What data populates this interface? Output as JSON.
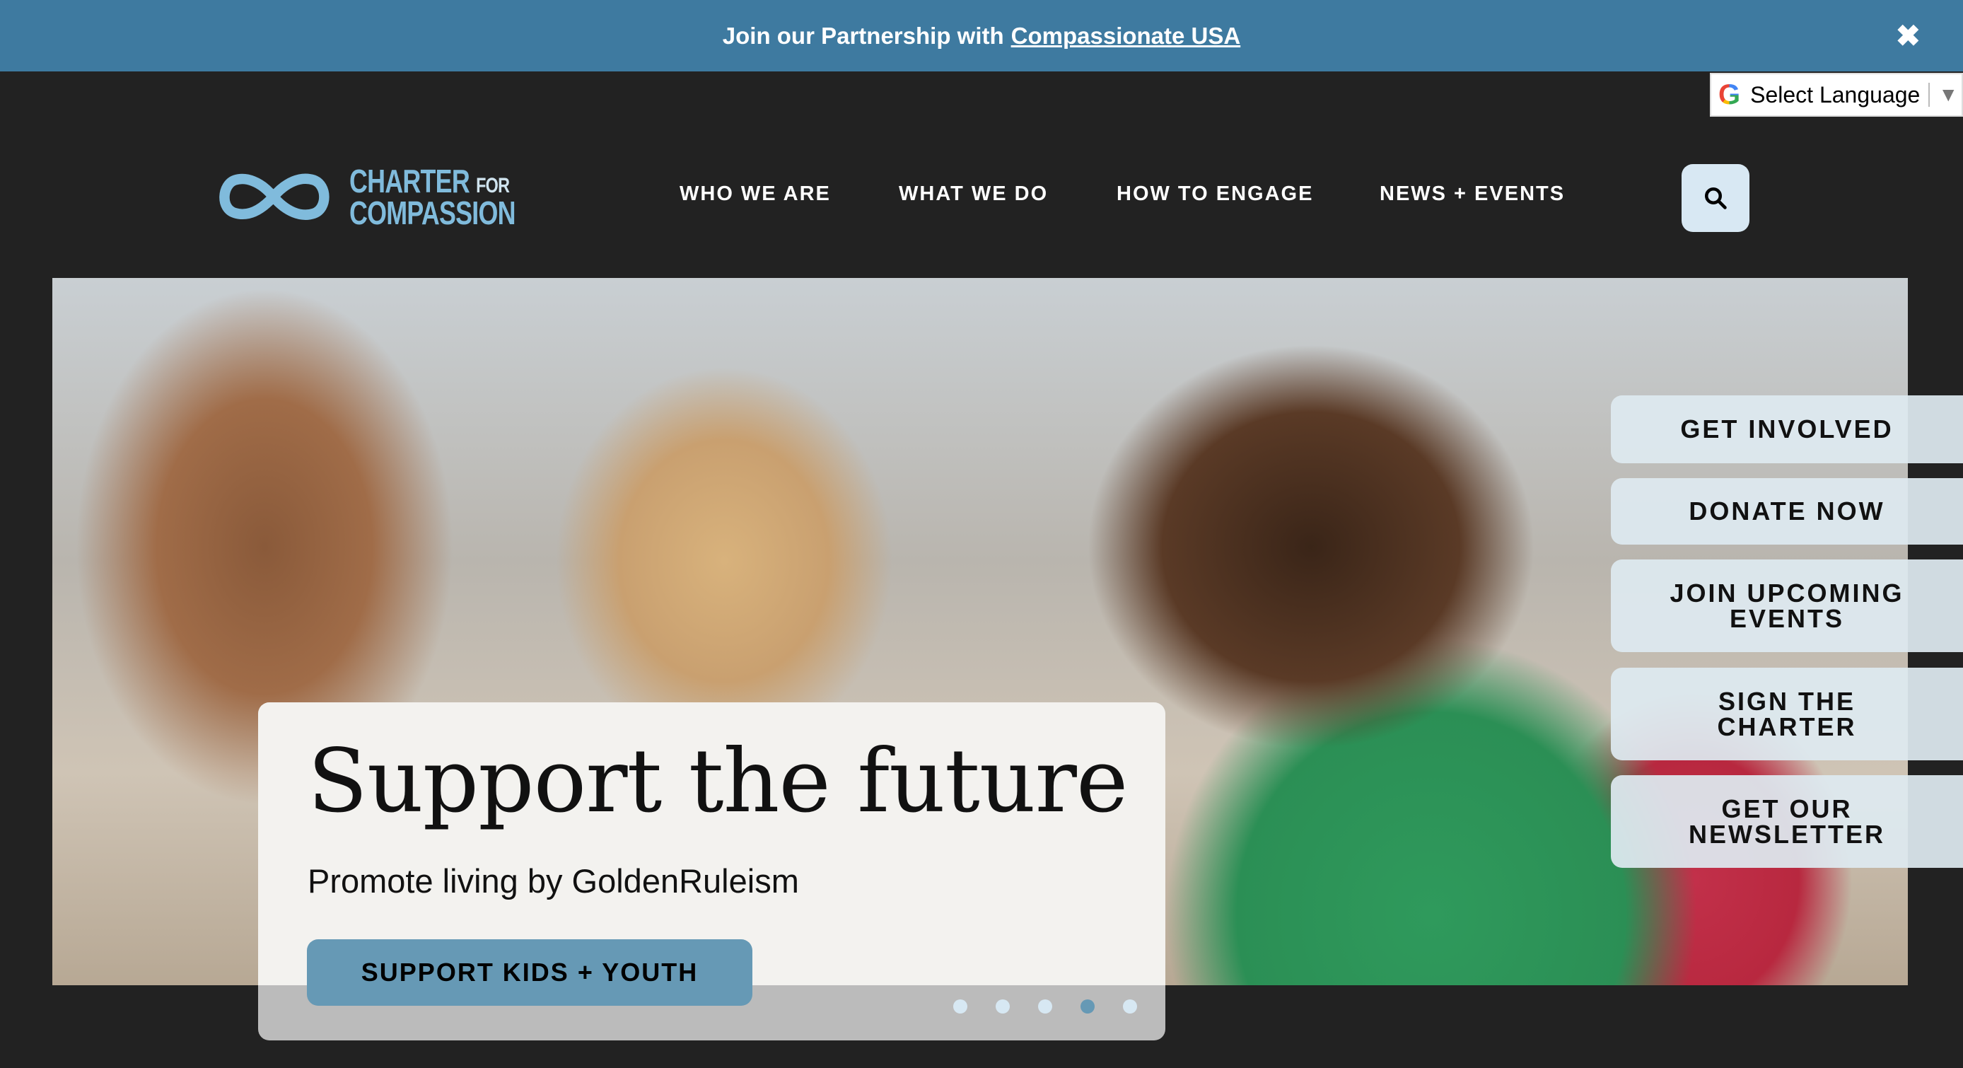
{
  "announcement": {
    "text": "Join our Partnership with",
    "link": "Compassionate USA",
    "close_icon": "close-icon"
  },
  "language": {
    "label": "Select Language",
    "icon": "google-icon"
  },
  "logo": {
    "line1": "CHARTER",
    "line1_small": "FOR",
    "line2": "COMPASSION",
    "color": "#80bbdc"
  },
  "nav": {
    "items": [
      {
        "label": "WHO WE ARE"
      },
      {
        "label": "WHAT WE DO"
      },
      {
        "label": "HOW TO ENGAGE"
      },
      {
        "label": "NEWS + EVENTS"
      }
    ],
    "search_icon": "search-icon"
  },
  "hero": {
    "title": "Support the future",
    "subtitle": "Promote living by GoldenRuleism",
    "cta": "SUPPORT KIDS + YOUTH",
    "slides": 5,
    "active_slide": 4
  },
  "side_actions": [
    {
      "label": "GET INVOLVED"
    },
    {
      "label": "DONATE NOW"
    },
    {
      "label": "JOIN UPCOMING EVENTS"
    },
    {
      "label": "SIGN THE CHARTER"
    },
    {
      "label": "GET OUR NEWSLETTER"
    }
  ],
  "colors": {
    "topbar": "#3e7aa0",
    "background": "#222222",
    "accent": "#6699b5",
    "search_bg": "#d8e8f3"
  }
}
